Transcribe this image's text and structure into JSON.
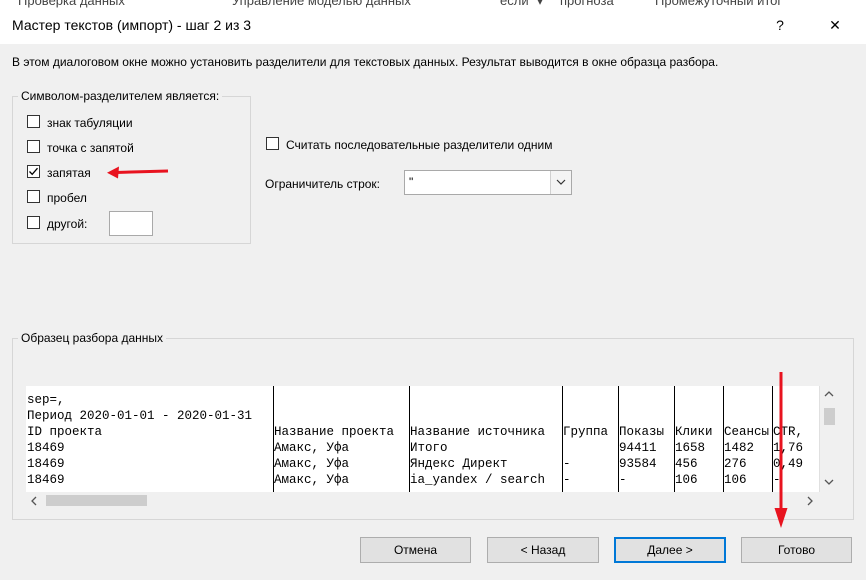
{
  "background_app": {
    "tabs": [
      "Проверка данных",
      "Управление моделью данных",
      "если\" ▾",
      "прогноза",
      "Промежуточный итог"
    ]
  },
  "dialog": {
    "title": "Мастер текстов (импорт) - шаг 2 из 3",
    "help_label": "?",
    "close_label": "✕",
    "intro": "В этом диалоговом окне можно установить разделители для текстовых данных. Результат выводится в окне образца разбора."
  },
  "delimiters": {
    "legend": "Символом-разделителем является:",
    "options": [
      {
        "label": "знак табуляции",
        "checked": false
      },
      {
        "label": "точка с запятой",
        "checked": false
      },
      {
        "label": "запятая",
        "checked": true
      },
      {
        "label": "пробел",
        "checked": false
      },
      {
        "label": "другой:",
        "checked": false
      }
    ],
    "other_value": ""
  },
  "consecutive": {
    "label": "Считать последовательные разделители одним",
    "checked": false
  },
  "qualifier": {
    "label": "Ограничитель строк:",
    "value": "\""
  },
  "preview": {
    "legend": "Образец разбора данных",
    "rows": [
      [
        "sep=,",
        "",
        "",
        "",
        "",
        "",
        "",
        ""
      ],
      [
        "Период 2020-01-01 - 2020-01-31",
        "",
        "",
        "",
        "",
        "",
        "",
        ""
      ],
      [
        "ID проекта",
        "Название проекта",
        "Название источника",
        "Группа",
        "Показы",
        "Клики",
        "Сеансы",
        "CTR,"
      ],
      [
        "18469",
        "Амакс, Уфа",
        "Итого",
        "",
        "94411",
        "1658",
        "1482",
        "1,76"
      ],
      [
        "18469",
        "Амакс, Уфа",
        "Яндекс Директ",
        "-",
        "93584",
        "456",
        "276",
        "0,49"
      ],
      [
        "18469",
        "Амакс, Уфа",
        "ia_yandex / search",
        "-",
        "-",
        "106",
        "106",
        "-"
      ]
    ]
  },
  "buttons": {
    "cancel": "Отмена",
    "back": "< Назад",
    "next": "Далее >",
    "finish": "Готово"
  },
  "colors": {
    "annotation_arrow": "#e8131f",
    "default_button_border": "#0078d7"
  }
}
